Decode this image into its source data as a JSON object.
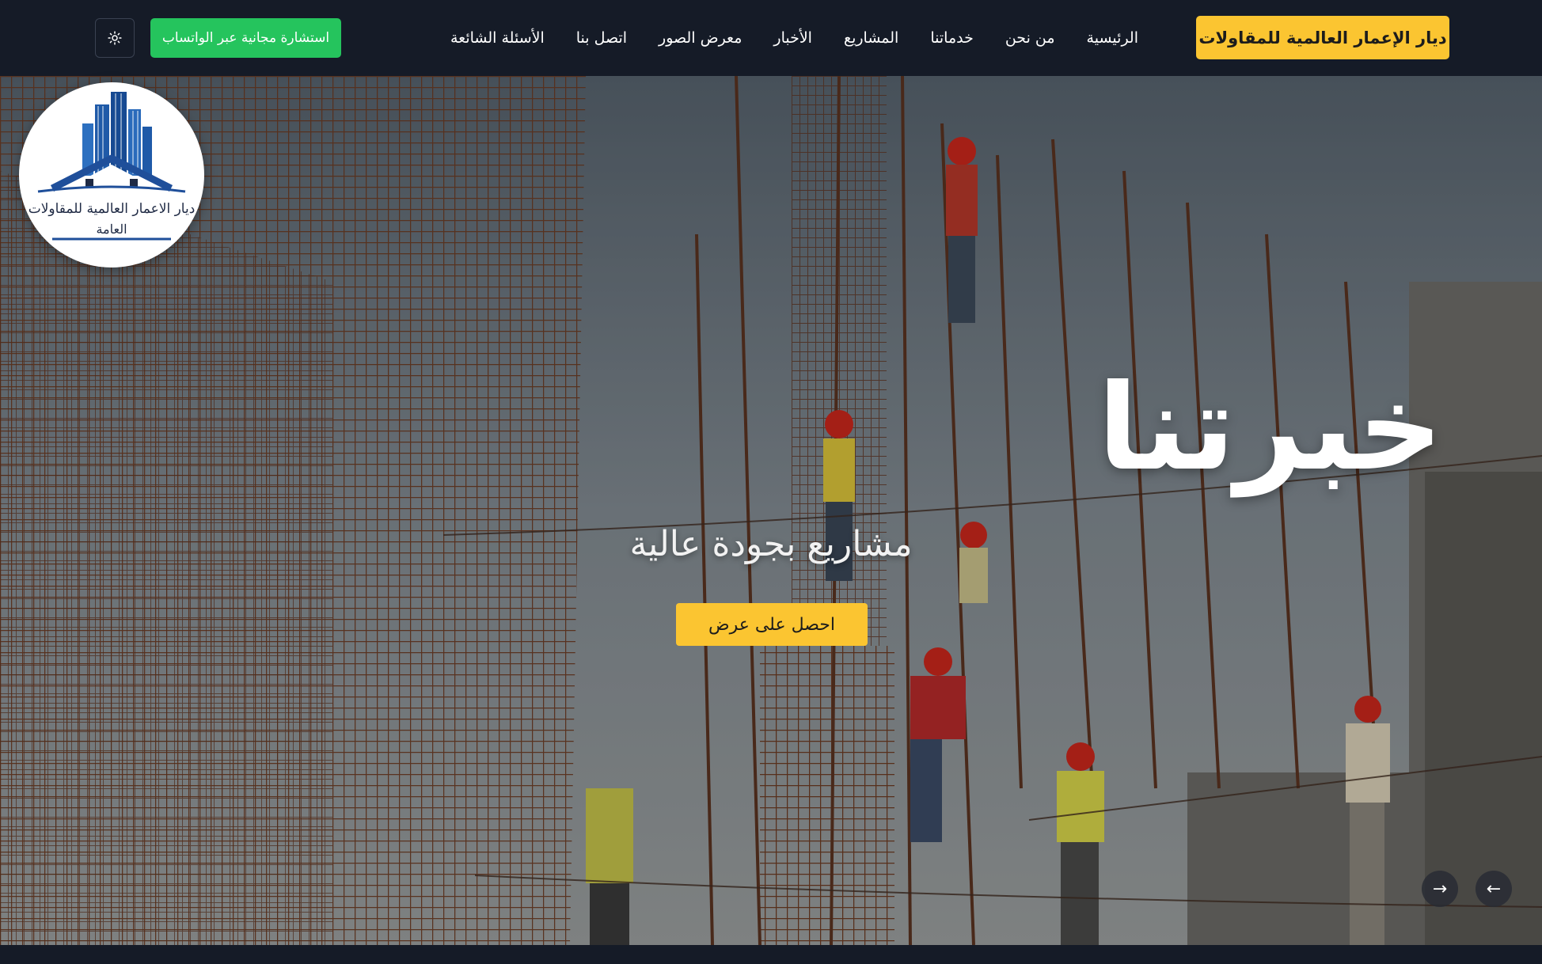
{
  "header": {
    "brand_label": "ديار الإعمار العالمية للمقاولات",
    "nav": [
      {
        "id": "home",
        "label": "الرئيسية"
      },
      {
        "id": "about",
        "label": "من نحن"
      },
      {
        "id": "services",
        "label": "خدماتنا"
      },
      {
        "id": "projects",
        "label": "المشاريع"
      },
      {
        "id": "news",
        "label": "الأخبار"
      },
      {
        "id": "gallery",
        "label": "معرض الصور"
      },
      {
        "id": "contact",
        "label": "اتصل بنا"
      },
      {
        "id": "faq",
        "label": "الأسئلة الشائعة"
      }
    ],
    "whatsapp_label": "استشارة مجانية عبر الواتساب",
    "theme_icon": "sun-icon"
  },
  "logo": {
    "line1": "ديار الاعمار العالمية للمقاولات",
    "line2": "العامة"
  },
  "hero": {
    "title": "خبرتنا",
    "subtitle": "مشاريع بجودة عالية",
    "cta_label": "احصل على عرض",
    "prev_arrow": "→",
    "next_arrow": "←"
  },
  "colors": {
    "header_bg": "#151b27",
    "accent_yellow": "#fbc531",
    "whatsapp_green": "#25c45d"
  }
}
